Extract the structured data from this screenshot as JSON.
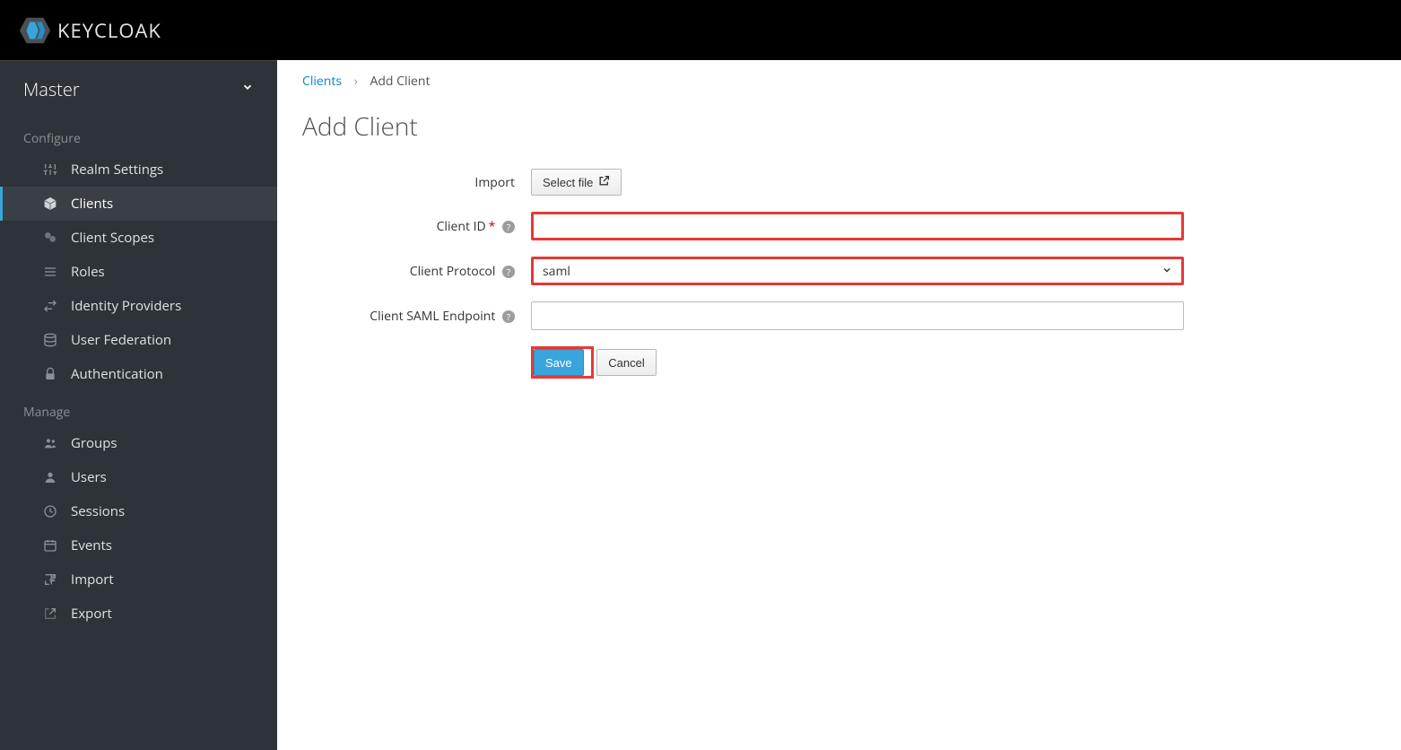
{
  "brand": {
    "name": "KEYCLOAK"
  },
  "realm": {
    "name": "Master"
  },
  "sidebar": {
    "section_configure": "Configure",
    "section_manage": "Manage",
    "configure": [
      {
        "label": "Realm Settings"
      },
      {
        "label": "Clients"
      },
      {
        "label": "Client Scopes"
      },
      {
        "label": "Roles"
      },
      {
        "label": "Identity Providers"
      },
      {
        "label": "User Federation"
      },
      {
        "label": "Authentication"
      }
    ],
    "manage": [
      {
        "label": "Groups"
      },
      {
        "label": "Users"
      },
      {
        "label": "Sessions"
      },
      {
        "label": "Events"
      },
      {
        "label": "Import"
      },
      {
        "label": "Export"
      }
    ]
  },
  "breadcrumb": {
    "parent": "Clients",
    "current": "Add Client"
  },
  "page": {
    "title": "Add Client"
  },
  "form": {
    "import_label": "Import",
    "select_file_label": "Select file",
    "client_id_label": "Client ID",
    "client_id_value": "",
    "client_protocol_label": "Client Protocol",
    "client_protocol_value": "saml",
    "saml_endpoint_label": "Client SAML Endpoint",
    "saml_endpoint_value": "",
    "save_label": "Save",
    "cancel_label": "Cancel"
  }
}
